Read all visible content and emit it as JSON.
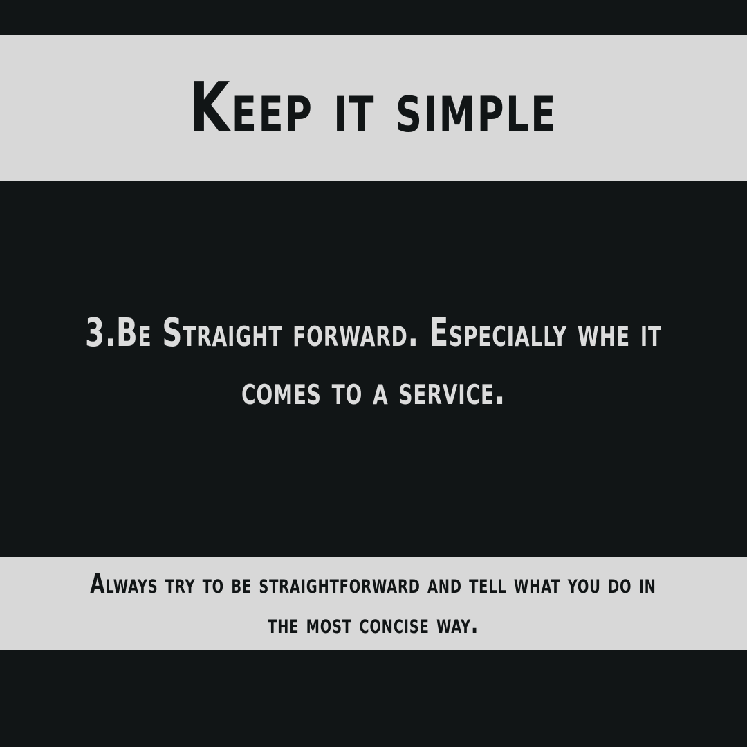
{
  "title": "Keep it simple",
  "main_point": {
    "line_1": "3.Be Straight forward. Especially whe it",
    "line_2": "comes to a service."
  },
  "note": {
    "line_1": "Always try to be straightforward and tell what you do in",
    "line_2": "the most concise way."
  },
  "colors": {
    "background": "#111516",
    "band": "#d8d8d8",
    "light_text": "#dcdcdc",
    "dark_text": "#111516"
  }
}
